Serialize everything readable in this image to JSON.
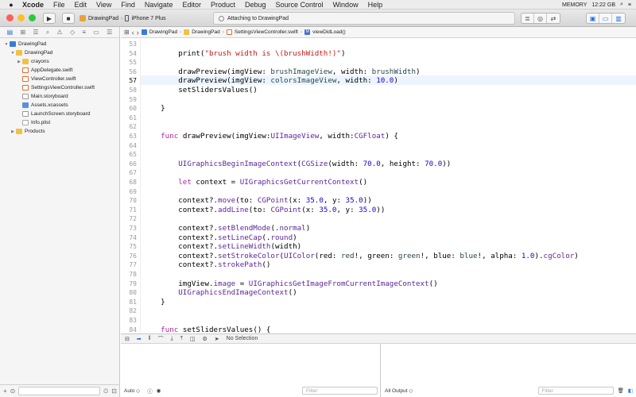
{
  "menubar": {
    "items": [
      "Xcode",
      "File",
      "Edit",
      "View",
      "Find",
      "Navigate",
      "Editor",
      "Product",
      "Debug",
      "Source Control",
      "Window",
      "Help"
    ],
    "clock": "12:22 GB",
    "memory": "MEMORY"
  },
  "toolbar": {
    "scheme": "DrawingPad",
    "device": "iPhone 7 Plus",
    "activity": "Attaching to DrawingPad"
  },
  "navigator": {
    "items": [
      {
        "label": "DrawingPad",
        "kind": "proj",
        "depth": 0,
        "disc": "▼"
      },
      {
        "label": "DrawingPad",
        "kind": "folder",
        "depth": 1,
        "disc": "▼"
      },
      {
        "label": "crayons",
        "kind": "folder",
        "depth": 2,
        "disc": "▶"
      },
      {
        "label": "AppDelegate.swift",
        "kind": "swift",
        "depth": 2,
        "disc": ""
      },
      {
        "label": "ViewController.swift",
        "kind": "swift",
        "depth": 2,
        "disc": ""
      },
      {
        "label": "SettingsViewController.swift",
        "kind": "swift",
        "depth": 2,
        "disc": ""
      },
      {
        "label": "Main.storyboard",
        "kind": "sb",
        "depth": 2,
        "disc": ""
      },
      {
        "label": "Assets.xcassets",
        "kind": "assets",
        "depth": 2,
        "disc": ""
      },
      {
        "label": "LaunchScreen.storyboard",
        "kind": "sb",
        "depth": 2,
        "disc": ""
      },
      {
        "label": "Info.plist",
        "kind": "plist",
        "depth": 2,
        "disc": ""
      },
      {
        "label": "Products",
        "kind": "folder",
        "depth": 1,
        "disc": "▶"
      }
    ]
  },
  "jumpbar": {
    "crumbs": [
      "DrawingPad",
      "DrawingPad",
      "SettingsViewController.swift",
      "viewDidLoad()"
    ]
  },
  "editor": {
    "current_line": "57",
    "lines": [
      {
        "n": "53",
        "html": ""
      },
      {
        "n": "54",
        "html": "        print(<span class=\"str\">\"brush width is \\(brushWidth!)\"</span>)"
      },
      {
        "n": "55",
        "html": ""
      },
      {
        "n": "56",
        "html": "        drawPreview(imgView: <span class=\"fn\">brushImageView</span>, width: <span class=\"fn\">brushWidth</span>)"
      },
      {
        "n": "57",
        "html": "        drawPreview(imgView: <span class=\"fn\">colorsImageView</span>, width: <span class=\"num\">10.0</span>)"
      },
      {
        "n": "58",
        "html": "        setSlidersValues()"
      },
      {
        "n": "59",
        "html": ""
      },
      {
        "n": "60",
        "html": "    }"
      },
      {
        "n": "61",
        "html": ""
      },
      {
        "n": "62",
        "html": ""
      },
      {
        "n": "63",
        "html": "    <span class=\"kw\">func</span> drawPreview(imgView:<span class=\"ty\">UIImageView</span>, width:<span class=\"ty\">CGFloat</span>) {"
      },
      {
        "n": "64",
        "html": ""
      },
      {
        "n": "65",
        "html": ""
      },
      {
        "n": "66",
        "html": "        <span class=\"ty\">UIGraphicsBeginImageContext</span>(<span class=\"ty\">CGSize</span>(width: <span class=\"num\">70.0</span>, height: <span class=\"num\">70.0</span>))"
      },
      {
        "n": "67",
        "html": ""
      },
      {
        "n": "68",
        "html": "        <span class=\"kw\">let</span> context = <span class=\"ty\">UIGraphicsGetCurrentContext</span>()"
      },
      {
        "n": "69",
        "html": ""
      },
      {
        "n": "70",
        "html": "        context?.<span class=\"ty\">move</span>(to: <span class=\"ty\">CGPoint</span>(x: <span class=\"num\">35.0</span>, y: <span class=\"num\">35.0</span>))"
      },
      {
        "n": "71",
        "html": "        context?.<span class=\"ty\">addLine</span>(to: <span class=\"ty\">CGPoint</span>(x: <span class=\"num\">35.0</span>, y: <span class=\"num\">35.0</span>))"
      },
      {
        "n": "72",
        "html": ""
      },
      {
        "n": "73",
        "html": "        context?.<span class=\"ty\">setBlendMode</span>(.<span class=\"ty\">normal</span>)"
      },
      {
        "n": "74",
        "html": "        context?.<span class=\"ty\">setLineCap</span>(.<span class=\"ty\">round</span>)"
      },
      {
        "n": "75",
        "html": "        context?.<span class=\"ty\">setLineWidth</span>(width)"
      },
      {
        "n": "76",
        "html": "        context?.<span class=\"ty\">setStrokeColor</span>(<span class=\"ty\">UIColor</span>(red: <span class=\"fn\">red</span>!, green: <span class=\"fn\">green</span>!, blue: <span class=\"fn\">blue</span>!, alpha: <span class=\"num\">1.0</span>).<span class=\"ty\">cgColor</span>)"
      },
      {
        "n": "77",
        "html": "        context?.<span class=\"ty\">strokePath</span>()"
      },
      {
        "n": "78",
        "html": ""
      },
      {
        "n": "79",
        "html": "        imgView.<span class=\"ty\">image</span> = <span class=\"ty\">UIGraphicsGetImageFromCurrentImageContext</span>()"
      },
      {
        "n": "80",
        "html": "        <span class=\"ty\">UIGraphicsEndImageContext</span>()"
      },
      {
        "n": "81",
        "html": "    }"
      },
      {
        "n": "82",
        "html": ""
      },
      {
        "n": "83",
        "html": ""
      },
      {
        "n": "84",
        "html": "    <span class=\"kw\">func</span> setSlidersValues() {"
      }
    ]
  },
  "debug": {
    "selection": "No Selection",
    "auto_label": "Auto ◇",
    "filter_placeholder": "Filter",
    "output_label": "All Output ◇"
  }
}
